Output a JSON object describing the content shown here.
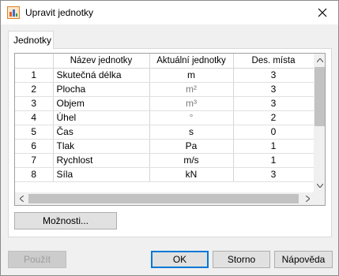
{
  "window": {
    "title": "Upravit jednotky",
    "close_symbol": "✕"
  },
  "tabs": [
    {
      "label": "Jednotky"
    }
  ],
  "table": {
    "columns": [
      "",
      "Název jednotky",
      "Aktuální jednotky",
      "Des. místa"
    ],
    "rows": [
      {
        "idx": "1",
        "name": "Skutečná délka",
        "unit": "m",
        "dec": "3"
      },
      {
        "idx": "2",
        "name": "Plocha",
        "unit": "m²",
        "dec": "3"
      },
      {
        "idx": "3",
        "name": "Objem",
        "unit": "m³",
        "dec": "3"
      },
      {
        "idx": "4",
        "name": "Úhel",
        "unit": "°",
        "dec": "2"
      },
      {
        "idx": "5",
        "name": "Čas",
        "unit": "s",
        "dec": "0"
      },
      {
        "idx": "6",
        "name": "Tlak",
        "unit": "Pa",
        "dec": "1"
      },
      {
        "idx": "7",
        "name": "Rychlost",
        "unit": "m/s",
        "dec": "1"
      },
      {
        "idx": "8",
        "name": "Síla",
        "unit": "kN",
        "dec": "3"
      }
    ]
  },
  "options_button": "Možnosti...",
  "footer": {
    "apply": "Použít",
    "ok": "OK",
    "cancel": "Storno",
    "help": "Nápověda"
  },
  "colors": {
    "accent": "#0078d7",
    "unit_muted": "#7a7a7a"
  },
  "icons": {
    "app": "app-icon",
    "close": "close-icon"
  }
}
